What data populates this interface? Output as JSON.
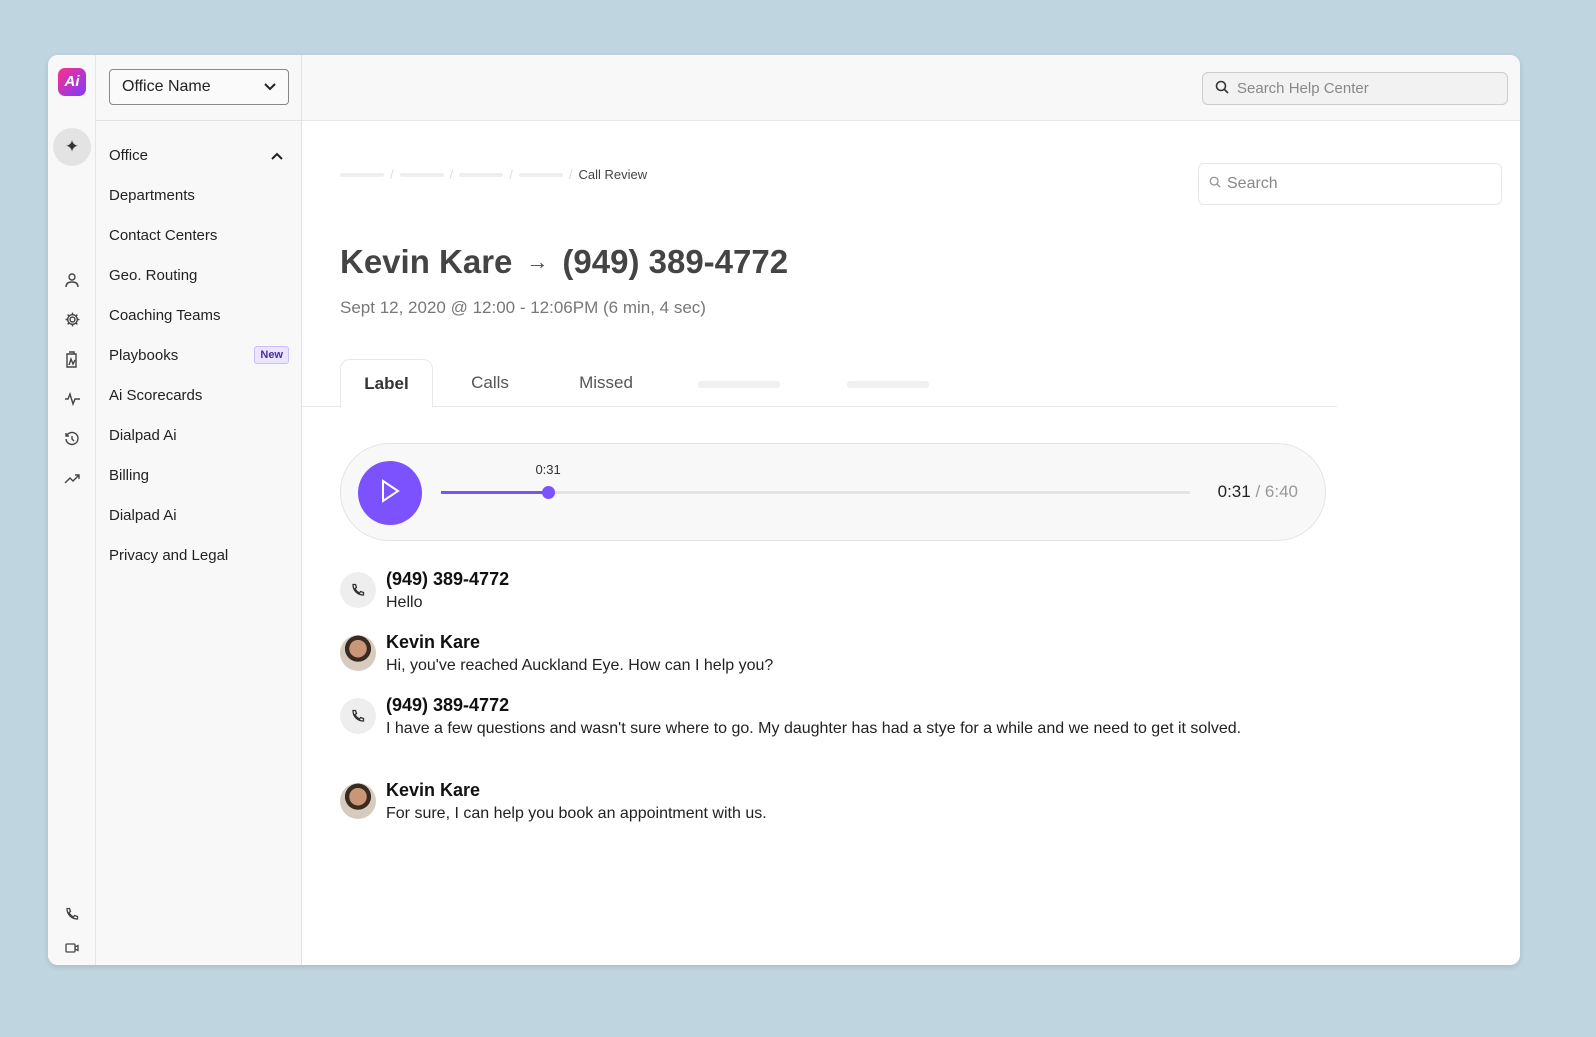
{
  "app": {
    "logo_text": "Ai"
  },
  "sidebar": {
    "office_select": "Office Name",
    "items": [
      {
        "label": "Office",
        "expanded": true
      },
      {
        "label": "Departments"
      },
      {
        "label": "Contact Centers"
      },
      {
        "label": "Geo. Routing"
      },
      {
        "label": "Coaching Teams"
      },
      {
        "label": "Playbooks",
        "badge": "New"
      },
      {
        "label": "Ai Scorecards"
      },
      {
        "label": "Dialpad Ai"
      },
      {
        "label": "Billing"
      },
      {
        "label": "Dialpad Ai"
      },
      {
        "label": "Privacy and Legal"
      }
    ]
  },
  "header": {
    "help_search_placeholder": "Search Help Center"
  },
  "main": {
    "breadcrumb_current": "Call Review",
    "search_placeholder": "Search",
    "caller": "Kevin Kare",
    "callee": "(949) 389-4772",
    "datetime": "Sept 12, 2020 @ 12:00 - 12:06PM (6 min, 4 sec)",
    "tabs": [
      "Label",
      "Calls",
      "Missed"
    ],
    "player": {
      "current": "0:31",
      "total": "6:40",
      "progress": 0.143,
      "separator": "/"
    },
    "transcript": [
      {
        "speaker": "(949) 389-4772",
        "type": "phone",
        "text": "Hello"
      },
      {
        "speaker": "Kevin Kare",
        "type": "agent",
        "text": "Hi, you've reached Auckland Eye. How can I help you?"
      },
      {
        "speaker": "(949) 389-4772",
        "type": "phone",
        "text": "I have a few questions and wasn't sure where to go. My daughter has had a stye for a while and we need to get it solved."
      },
      {
        "speaker": "Kevin Kare",
        "type": "agent",
        "text": "For sure, I can help you book an appointment with us."
      }
    ]
  },
  "colors": {
    "accent": "#7c52ff",
    "background": "#bfd5df"
  }
}
